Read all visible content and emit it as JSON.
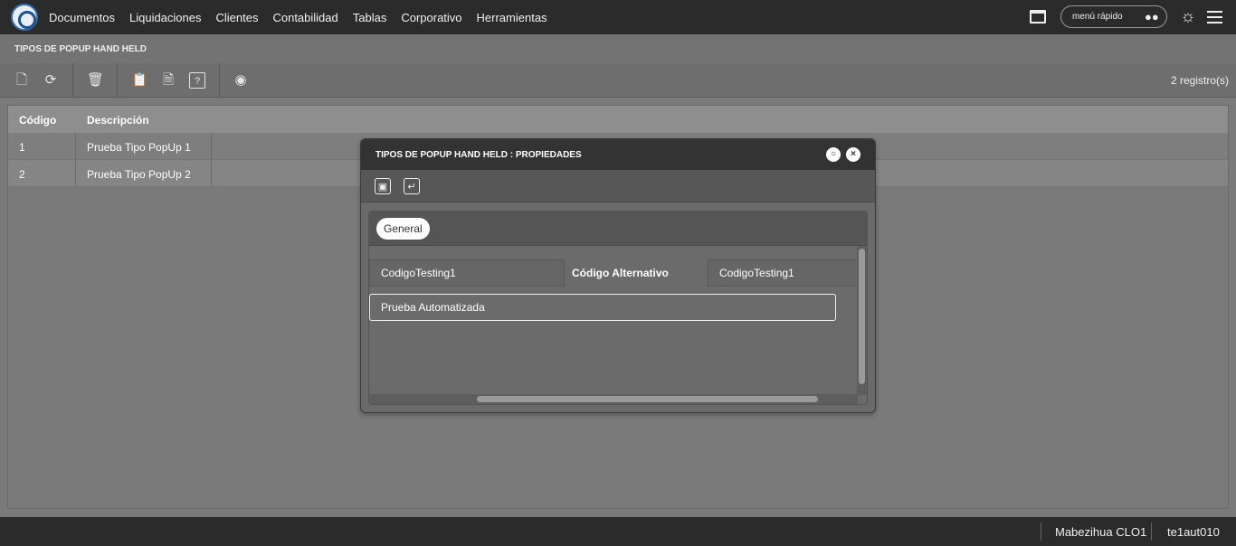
{
  "topbar": {
    "nav": [
      "Documentos",
      "Liquidaciones",
      "Clientes",
      "Contabilidad",
      "Tablas",
      "Corporativo",
      "Herramientas"
    ],
    "quick_menu": "menú rápido"
  },
  "page": {
    "title": "TIPOS DE POPUP HAND HELD",
    "record_count": "2 registro(s)"
  },
  "grid": {
    "columns": [
      "Código",
      "Descripción"
    ],
    "rows": [
      {
        "code": "1",
        "description": "Prueba Tipo PopUp 1"
      },
      {
        "code": "2",
        "description": "Prueba Tipo PopUp 2"
      }
    ]
  },
  "dialog": {
    "title": "TIPOS DE POPUP HAND HELD : PROPIEDADES",
    "tab": "General",
    "code_value": "CodigoTesting1",
    "alt_code_label": "Código Alternativo",
    "alt_code_value": "CodigoTesting1",
    "description_value": "Prueba Automatizada"
  },
  "footer": {
    "user": "Mabezihua CLO1",
    "session": "te1aut010"
  },
  "icons": [
    "app-logo-icon",
    "window-icon",
    "binoculars-icon",
    "theme-sun-icon",
    "hamburger-menu-icon",
    "new-document-icon",
    "refresh-icon",
    "delete-icon",
    "clipboard-icon",
    "export-xls-icon",
    "help-icon",
    "search-binoculars-icon",
    "save-icon",
    "return-icon",
    "restore-icon",
    "close-icon"
  ]
}
